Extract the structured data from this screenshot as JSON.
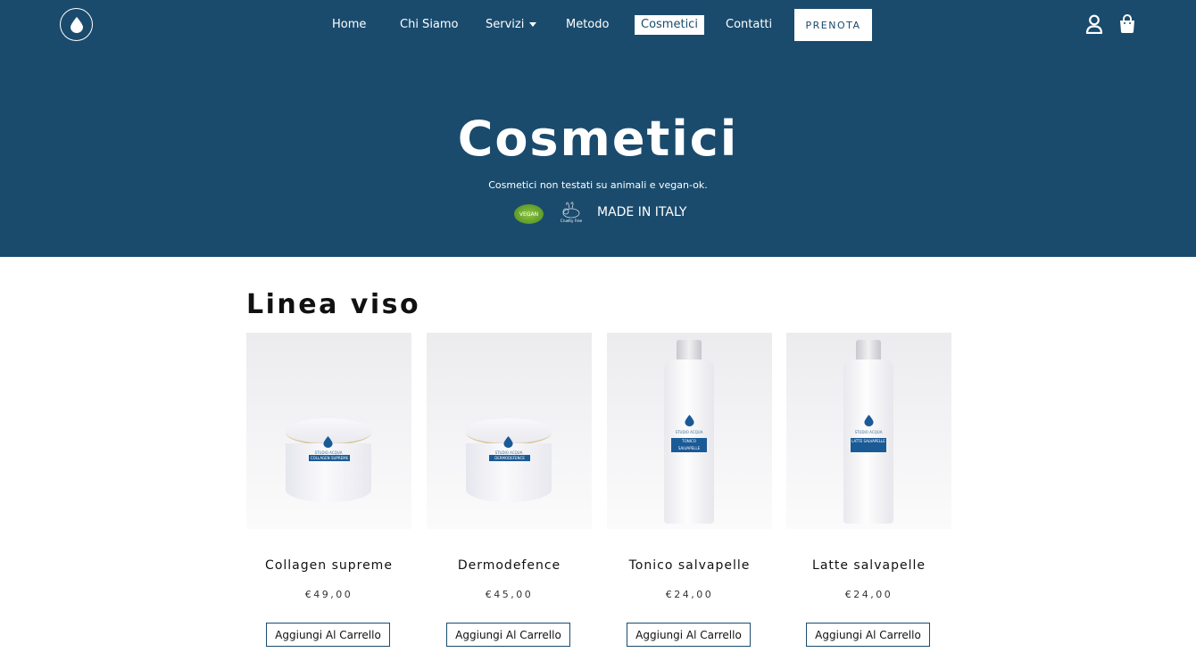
{
  "nav": {
    "items": [
      {
        "label": "Home",
        "active": false
      },
      {
        "label": "Chi Siamo",
        "active": false
      },
      {
        "label": "Servizi",
        "active": false,
        "has_dropdown": true
      },
      {
        "label": "Metodo",
        "active": false
      },
      {
        "label": "Cosmetici",
        "active": true
      },
      {
        "label": "Contatti",
        "active": false
      }
    ],
    "cta_label": "PRENOTA",
    "icons": {
      "logo": "water-drop-icon",
      "account": "user-icon",
      "cart": "shopping-bag-icon"
    }
  },
  "hero": {
    "title": "Cosmetici",
    "subtitle": "Cosmetici non testati su animali e vegan-ok.",
    "badges": {
      "vegan": "VEGAN",
      "cruelty_free": "Cruelty Free",
      "made_in": "MADE IN ITALY"
    }
  },
  "section": {
    "title": "Linea viso"
  },
  "products": [
    {
      "name": "Collagen supreme",
      "price": "€49,00",
      "button": "Aggiungi Al Carrello",
      "image_kind": "jar",
      "brand": "STUDIO ACQUA",
      "label": "COLLAGEN SUPREME"
    },
    {
      "name": "Dermodefence",
      "price": "€45,00",
      "button": "Aggiungi Al Carrello",
      "image_kind": "jar",
      "brand": "STUDIO ACQUA",
      "label": "DERMODEFENCE"
    },
    {
      "name": "Tonico salvapelle",
      "price": "€24,00",
      "button": "Aggiungi Al Carrello",
      "image_kind": "bottle",
      "brand": "STUDIO ACQUA",
      "label": "TONICO SALVAPELLE"
    },
    {
      "name": "Latte salvapelle",
      "price": "€24,00",
      "button": "Aggiungi Al Carrello",
      "image_kind": "bottle",
      "brand": "STUDIO ACQUA",
      "label": "LATTE SALVAPELLE"
    }
  ],
  "colors": {
    "brand": "#1a4b6d",
    "label_blue": "#1a5a96",
    "background": "#ffffff"
  }
}
